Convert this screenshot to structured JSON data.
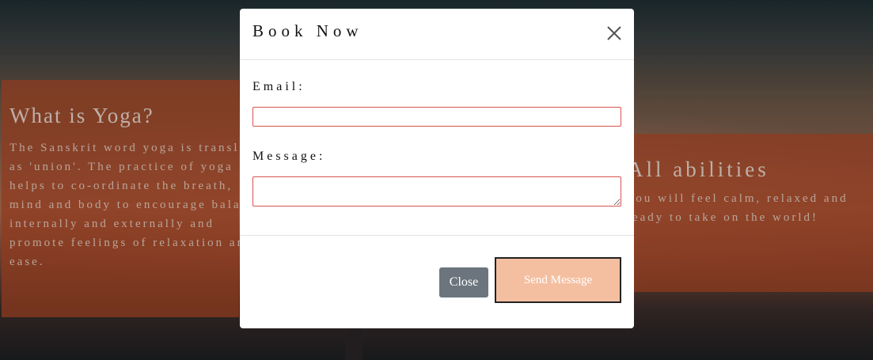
{
  "background": {
    "left_panel": {
      "title": "What is Yoga?",
      "text": "The Sanskrit word yoga is translated as 'union'. The practice of yoga helps to co-ordinate the breath, mind and body to encourage balance, internally and externally and promote feelings of relaxation and ease."
    },
    "right_panel": {
      "title": "All abilities",
      "text": "You will feel calm, relaxed and ready to take on the world!"
    }
  },
  "modal": {
    "title": "Book Now",
    "close_icon": "close-icon",
    "email_label": "Email:",
    "email_value": "",
    "message_label": "Message:",
    "message_value": "",
    "close_button": "Close",
    "send_button": "Send Message"
  },
  "colors": {
    "panel": "#b04826",
    "close_button_bg": "#6c757d",
    "send_button_bg": "#f4bfa1",
    "input_border": "#d9534f"
  }
}
